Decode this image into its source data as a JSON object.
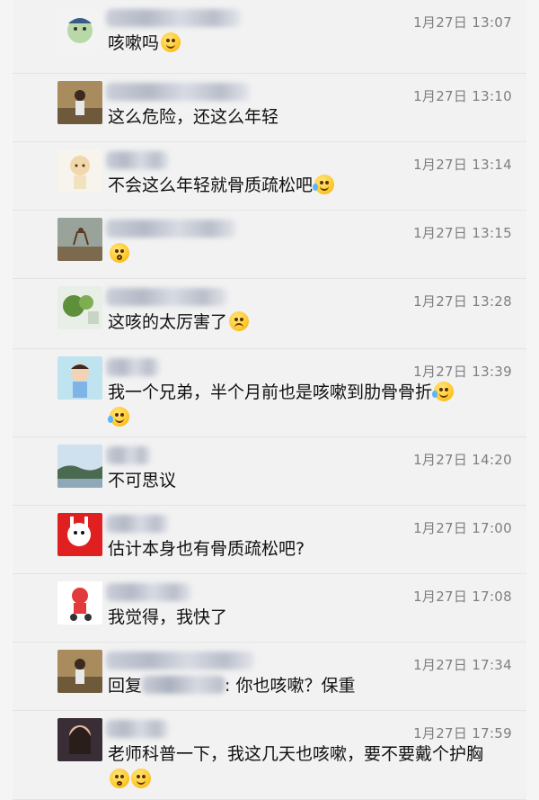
{
  "comments": [
    {
      "time": "1月27日 13:07",
      "text": "咳嗽吗",
      "emoji": [
        "grin-sweat-icon"
      ]
    },
    {
      "time": "1月27日 13:10",
      "text": "这么危险，还这么年轻",
      "emoji": []
    },
    {
      "time": "1月27日 13:14",
      "text": "不会这么年轻就骨质疏松吧",
      "emoji": [
        "laugh-cry-icon"
      ]
    },
    {
      "time": "1月27日 13:15",
      "text": "",
      "emoji": [
        "shocked-icon"
      ]
    },
    {
      "time": "1月27日 13:28",
      "text": "这咳的太厉害了",
      "emoji": [
        "wince-icon"
      ]
    },
    {
      "time": "1月27日 13:39",
      "text": "我一个兄弟，半个月前也是咳嗽到肋骨骨折",
      "emoji": [
        "laugh-cry-icon",
        "laugh-cry-icon"
      ]
    },
    {
      "time": "1月27日 14:20",
      "text": "不可思议",
      "emoji": []
    },
    {
      "time": "1月27日 17:00",
      "text": "估计本身也有骨质疏松吧?",
      "emoji": []
    },
    {
      "time": "1月27日 17:08",
      "text": "我觉得，我快了",
      "emoji": []
    },
    {
      "time": "1月27日 17:34",
      "text_prefix": "回复",
      "text_suffix": ": 你也咳嗽？保重",
      "emoji": []
    },
    {
      "time": "1月27日 17:59",
      "text": "老师科普一下，我这几天也咳嗽，要不要戴个护胸",
      "emoji": [
        "flushed-icon",
        "dizzy-icon"
      ]
    }
  ]
}
